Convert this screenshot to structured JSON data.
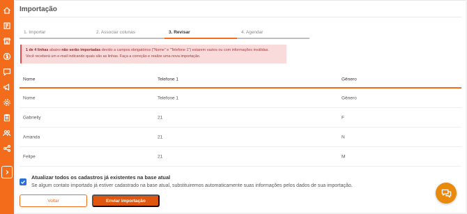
{
  "sidebar": {
    "icons": [
      "home-icon",
      "book-icon",
      "store-icon",
      "dollar-icon",
      "chat-chart-icon",
      "megaphone-icon",
      "settings-icon",
      "clipboard-icon",
      "users-icon",
      "share-icon"
    ],
    "toggle_icon": "chevron-right-icon",
    "color": "#f26c1c"
  },
  "page": {
    "title": "Importação"
  },
  "steps": [
    {
      "label": "1. Importar",
      "active": false
    },
    {
      "label": "2. Associar colunas",
      "active": false
    },
    {
      "label": "3. Revisar",
      "active": true
    },
    {
      "label": "4. Agendar",
      "active": false
    }
  ],
  "alert": {
    "count_text": "1 de 4 linhas",
    "text_a": " abaixo ",
    "bold_b": "não serão importadas",
    "text_c": " devido a campos obrigatórios (\"Nome\" e \"Telefone 1\") estarem vazios ou com informações inválidas.",
    "line2": "Você receberá um e-mail indicando quais são as linhas. Faça a correção e realize uma nova importação.",
    "color": "#fadbdb"
  },
  "table": {
    "headers": [
      "Nome",
      "Telefone 1",
      "Gênero"
    ],
    "rows": [
      [
        "Nome",
        "Telefone 1",
        "Gênero"
      ],
      [
        "Gabrielly",
        "21",
        "F"
      ],
      [
        "Amanda",
        "21",
        "N"
      ],
      [
        "Felipe",
        "21",
        "M"
      ]
    ]
  },
  "option": {
    "checked": true,
    "title": "Atualizar todos os cadastros já existentes na base atual",
    "description": "Se algum contato importado já estiver cadastrado na base atual, substituiremos automaticamente suas informações pelos dados de sua importação."
  },
  "buttons": {
    "back": "Voltar",
    "submit": "Enviar importação"
  },
  "chat_icon": "chat-bubble-icon",
  "accent_color": "#f26c1c"
}
